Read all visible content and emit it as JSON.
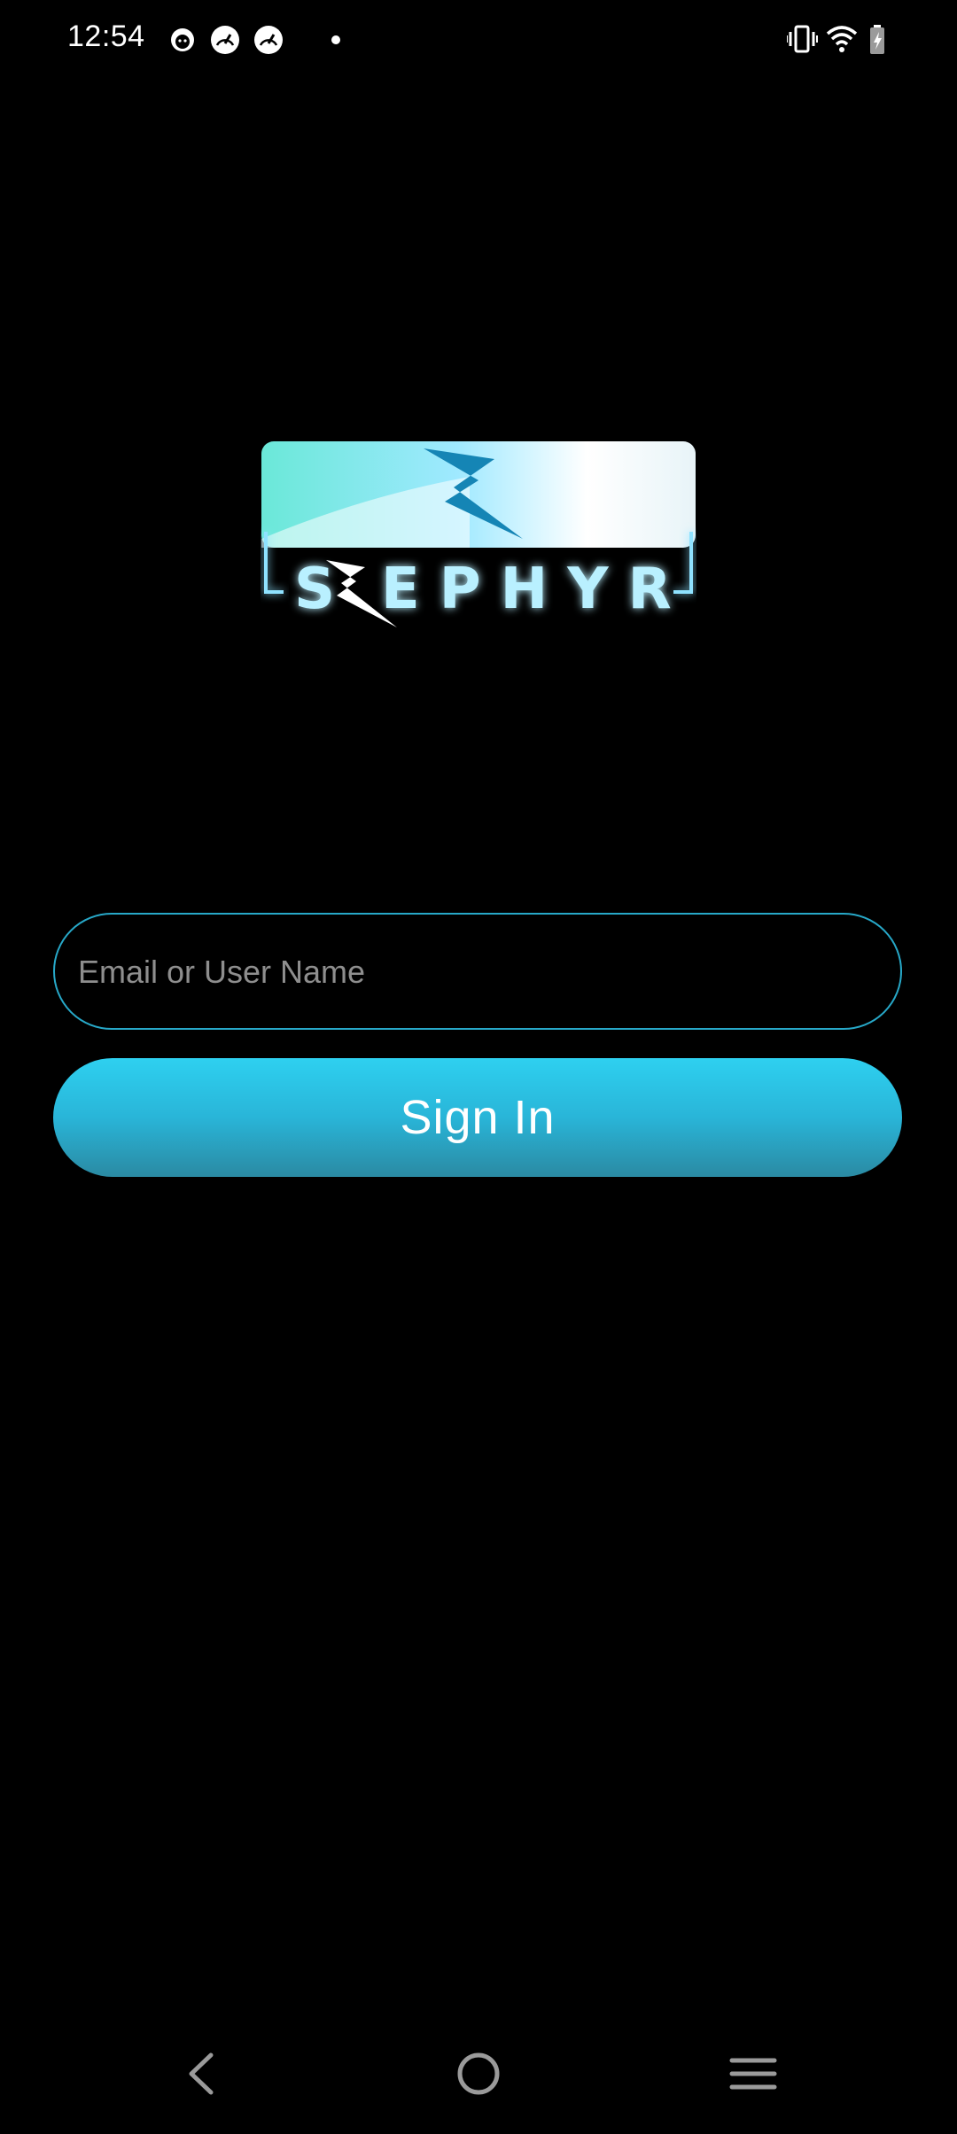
{
  "status_bar": {
    "time": "12:54",
    "notification_icons": [
      "cat-face-icon",
      "speedometer-icon",
      "speedometer-icon",
      "dot-icon"
    ],
    "system_icons": [
      "vibrate-icon",
      "wifi-icon",
      "battery-charging-icon"
    ]
  },
  "logo": {
    "text": "ZEPHYR",
    "colors": {
      "glow": "#7fe0ff",
      "teal": "#5fe8dc",
      "bolt": "#1585b5"
    }
  },
  "login": {
    "email_placeholder": "Email or User Name",
    "email_value": "",
    "sign_in_label": "Sign In"
  },
  "nav_bar": {
    "buttons": [
      "back-icon",
      "home-icon",
      "menu-icon"
    ]
  },
  "colors": {
    "background": "#000000",
    "accent": "#2ed0f0",
    "field_border": "#27a8c8",
    "placeholder": "#8e8e8e"
  }
}
